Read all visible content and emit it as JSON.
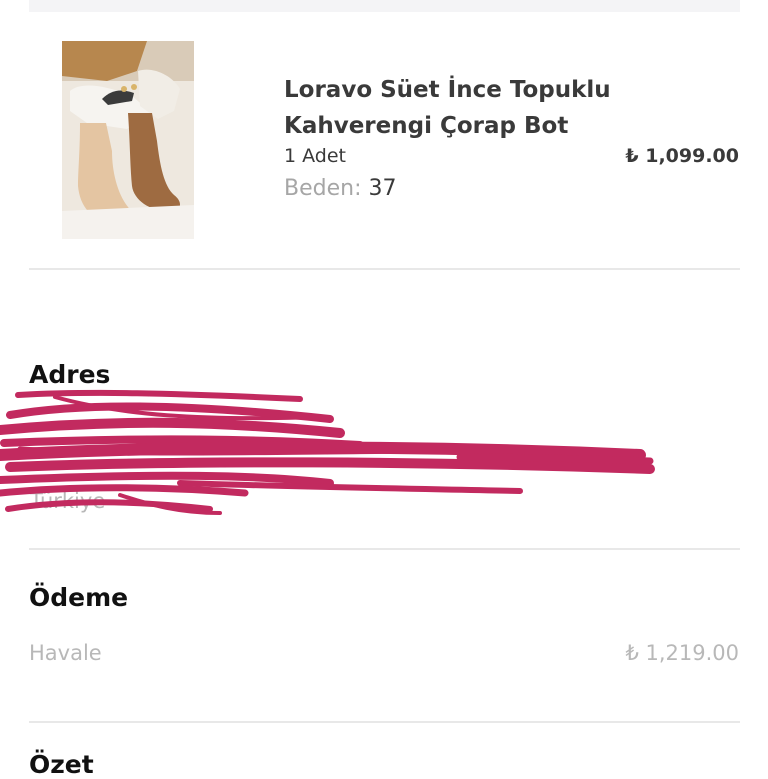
{
  "product": {
    "name_line1": "Loravo Süet İnce Topuklu",
    "name_line2": "Kahverengi Çorap Bot",
    "quantity": "1 Adet",
    "price": "₺ 1,099.00",
    "size_label": "Beden:",
    "size_value": "37",
    "image_icon": "boots-photo"
  },
  "address": {
    "title": "Adres",
    "line1": "",
    "line2": "",
    "country": "Türkiye",
    "redaction_color": "#c22a5f"
  },
  "payment": {
    "title": "Ödeme",
    "method": "Havale",
    "amount": "₺ 1,219.00"
  },
  "summary": {
    "title": "Özet"
  }
}
